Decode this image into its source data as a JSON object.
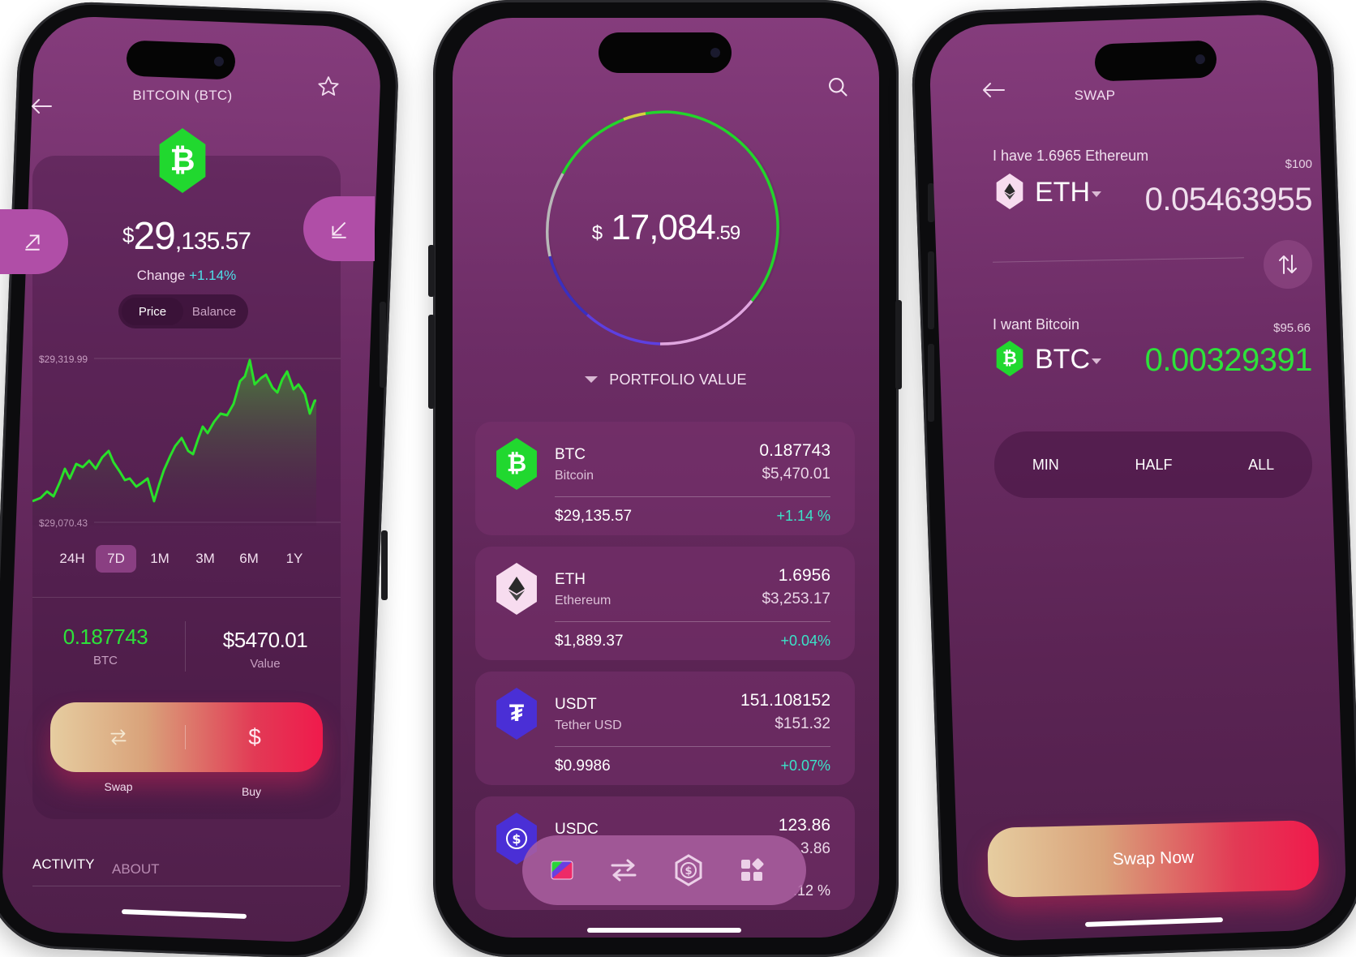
{
  "coin_detail": {
    "title": "BITCOIN (BTC)",
    "price_currency": "$",
    "price_int": "29",
    "price_rest": ",135.57",
    "change_label": "Change",
    "change_value": "+1.14%",
    "toggle": [
      "Price",
      "Balance"
    ],
    "chart_high": "$29,319.99",
    "chart_low": "$29,070.43",
    "ranges": [
      "24H",
      "7D",
      "1M",
      "3M",
      "6M",
      "1Y"
    ],
    "selected_range": "7D",
    "holding_amount": "0.187743",
    "holding_unit": "BTC",
    "holding_value": "$5470.01",
    "holding_value_label": "Value",
    "swap_label": "Swap",
    "buy_label": "Buy",
    "tab_activity": "ACTIVITY",
    "tab_about": "ABOUT"
  },
  "portfolio": {
    "total_currency": "$",
    "total_int": "17,084",
    "total_dec": ".59",
    "label": "PORTFOLIO VALUE",
    "assets": [
      {
        "symbol": "BTC",
        "name": "Bitcoin",
        "amount": "0.187743",
        "value": "$5,470.01",
        "price": "$29,135.57",
        "change": "+1.14 %",
        "color": "#21d82f"
      },
      {
        "symbol": "ETH",
        "name": "Ethereum",
        "amount": "1.6956",
        "value": "$3,253.17",
        "price": "$1,889.37",
        "change": "+0.04%",
        "color": "#f7dcef"
      },
      {
        "symbol": "USDT",
        "name": "Tether USD",
        "amount": "151.108152",
        "value": "$151.32",
        "price": "$0.9986",
        "change": "+0.07%",
        "color": "#4a2fd6"
      },
      {
        "symbol": "USDC",
        "name": "",
        "amount": "123.86",
        "value": "3.86",
        "price": "",
        "change": ".12 %",
        "color": "#4a2fd6"
      }
    ]
  },
  "swap": {
    "title": "SWAP",
    "have_label": "I have 1.6965 Ethereum",
    "have_usd": "$100",
    "have_symbol": "ETH",
    "have_amount": "0.05463955",
    "want_label": "I want Bitcoin",
    "want_usd": "$95.66",
    "want_symbol": "BTC",
    "want_amount": "0.00329391",
    "chips": [
      "MIN",
      "HALF",
      "ALL"
    ],
    "cta": "Swap Now"
  },
  "colors": {
    "accent_green": "#21d82f",
    "positive_teal": "#3be3c8",
    "cta_pink": "#f01a4c"
  }
}
